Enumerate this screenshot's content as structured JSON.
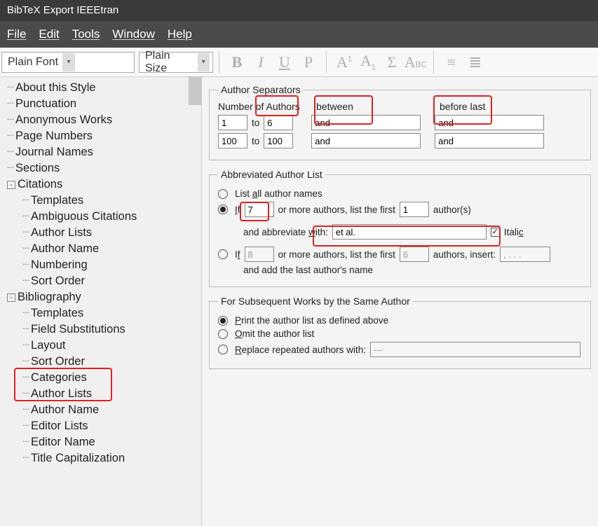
{
  "title": "BibTeX Export IEEEtran",
  "menu": {
    "file": "File",
    "edit": "Edit",
    "tools": "Tools",
    "window": "Window",
    "help": "Help"
  },
  "toolbar": {
    "font": "Plain Font",
    "size": "Plain Size"
  },
  "tree": {
    "items": [
      "About this Style",
      "Punctuation",
      "Anonymous Works",
      "Page Numbers",
      "Journal Names",
      "Sections"
    ],
    "citations": "Citations",
    "citations_children": [
      "Templates",
      "Ambiguous Citations",
      "Author Lists",
      "Author Name",
      "Numbering",
      "Sort Order"
    ],
    "bibliography": "Bibliography",
    "bib_children": [
      "Templates",
      "Field Substitutions",
      "Layout",
      "Sort Order",
      "Categories",
      "Author Lists",
      "Author Name",
      "Editor Lists",
      "Editor Name",
      "Title Capitalization"
    ]
  },
  "sep": {
    "legend": "Author Separators",
    "hdr_num": "Number of Authors",
    "hdr_between": "between",
    "hdr_before": "before last",
    "to": "to",
    "r1_from": "1",
    "r1_to": "6",
    "r1_between": "and",
    "r1_before": "and",
    "r2_from": "100",
    "r2_to": "100",
    "r2_between": "and",
    "r2_before": "and"
  },
  "abbr": {
    "legend": "Abbreviated Author List",
    "opt_all": "List all author names",
    "if": "If",
    "or_more": "or more authors, list the first",
    "authors": "author(s)",
    "v_if": "7",
    "v_first": "1",
    "and_abbr": "and abbreviate with:",
    "etal": "et al.",
    "italic": "Italic",
    "v_if2": "8",
    "v_first2": "6",
    "insert": "authors, insert:",
    "dots": ", . . .",
    "add_last": "and add the last author's name"
  },
  "subseq": {
    "legend": "For Subsequent Works by the Same Author",
    "opt_print": "Print the author list as defined above",
    "opt_omit": "Omit the author list",
    "opt_replace": "Replace repeated authors with:",
    "dash": "---"
  }
}
